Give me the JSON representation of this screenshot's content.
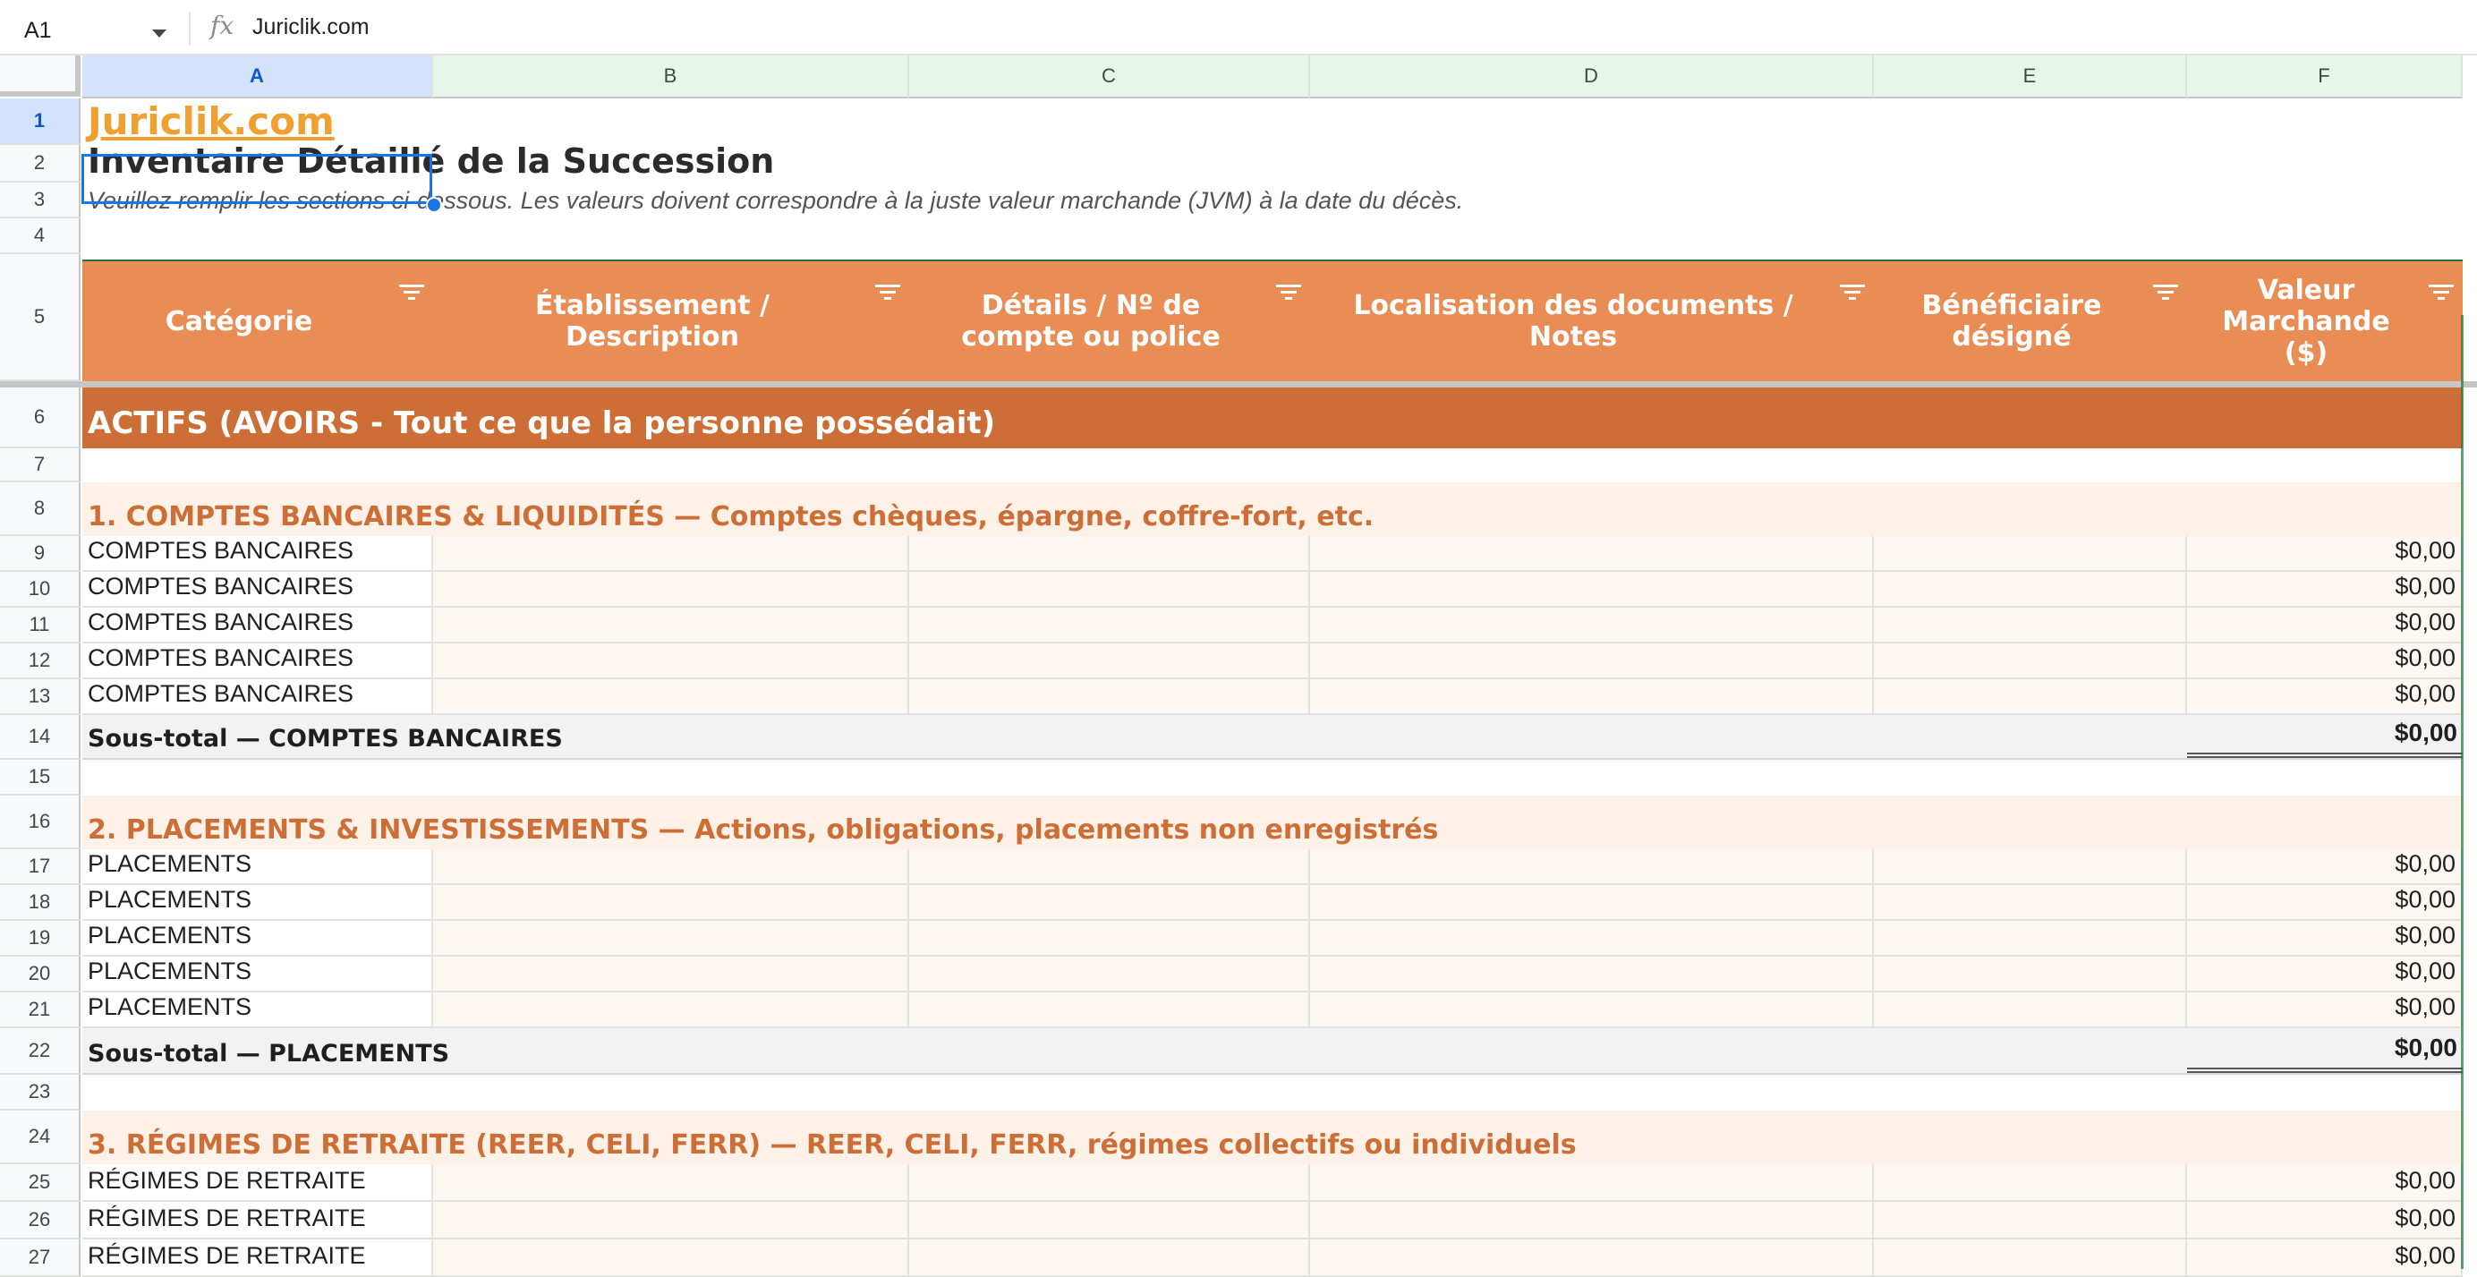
{
  "formula_bar": {
    "cell_ref": "A1",
    "fx_label": "fx",
    "content": "Juriclik.com"
  },
  "columns": [
    "A",
    "B",
    "C",
    "D",
    "E",
    "F"
  ],
  "row_numbers": [
    "1",
    "2",
    "3",
    "4",
    "5",
    "6",
    "7",
    "8",
    "9",
    "10",
    "11",
    "12",
    "13",
    "14",
    "15",
    "16",
    "17",
    "18",
    "19",
    "20",
    "21",
    "22",
    "23",
    "24",
    "25",
    "26",
    "27"
  ],
  "sheet": {
    "brand": "Juriclik.com",
    "title": "Inventaire Détaillé de la Succession",
    "subtitle": "Veuillez remplir les sections ci-dessous. Les valeurs doivent correspondre à la juste valeur marchande (JVM) à la date du décès.",
    "headers": [
      "Catégorie",
      "Établissement / Description",
      "Détails / Nº de compte ou police",
      "Localisation des documents / Notes",
      "Bénéficiaire désigné",
      "Valeur Marchande ($)"
    ],
    "assets_section": "ACTIFS (AVOIRS - Tout ce que la personne possédait)",
    "groups": [
      {
        "heading": "1. COMPTES BANCAIRES & LIQUIDITÉS — Comptes chèques, épargne, coffre-fort, etc.",
        "rows": [
          {
            "category": "COMPTES BANCAIRES",
            "value": "$0,00"
          },
          {
            "category": "COMPTES BANCAIRES",
            "value": "$0,00"
          },
          {
            "category": "COMPTES BANCAIRES",
            "value": "$0,00"
          },
          {
            "category": "COMPTES BANCAIRES",
            "value": "$0,00"
          },
          {
            "category": "COMPTES BANCAIRES",
            "value": "$0,00"
          }
        ],
        "subtotal_label": "Sous-total — COMPTES BANCAIRES",
        "subtotal_value": "$0,00"
      },
      {
        "heading": "2. PLACEMENTS & INVESTISSEMENTS — Actions, obligations, placements non enregistrés",
        "rows": [
          {
            "category": "PLACEMENTS",
            "value": "$0,00"
          },
          {
            "category": "PLACEMENTS",
            "value": "$0,00"
          },
          {
            "category": "PLACEMENTS",
            "value": "$0,00"
          },
          {
            "category": "PLACEMENTS",
            "value": "$0,00"
          },
          {
            "category": "PLACEMENTS",
            "value": "$0,00"
          }
        ],
        "subtotal_label": "Sous-total — PLACEMENTS",
        "subtotal_value": "$0,00"
      },
      {
        "heading": "3. RÉGIMES DE RETRAITE (REER, CELI, FERR) — REER, CELI, FERR, régimes collectifs ou individuels",
        "rows": [
          {
            "category": "RÉGIMES DE RETRAITE",
            "value": "$0,00"
          },
          {
            "category": "RÉGIMES DE RETRAITE",
            "value": "$0,00"
          },
          {
            "category": "RÉGIMES DE RETRAITE",
            "value": "$0,00"
          }
        ]
      }
    ]
  },
  "colors": {
    "brand_orange": "#f0a030",
    "header_orange": "#ea8d55",
    "section_orange": "#cd6e36",
    "subheader_tint": "#fdf1e8",
    "selection_blue": "#1a73e8"
  }
}
